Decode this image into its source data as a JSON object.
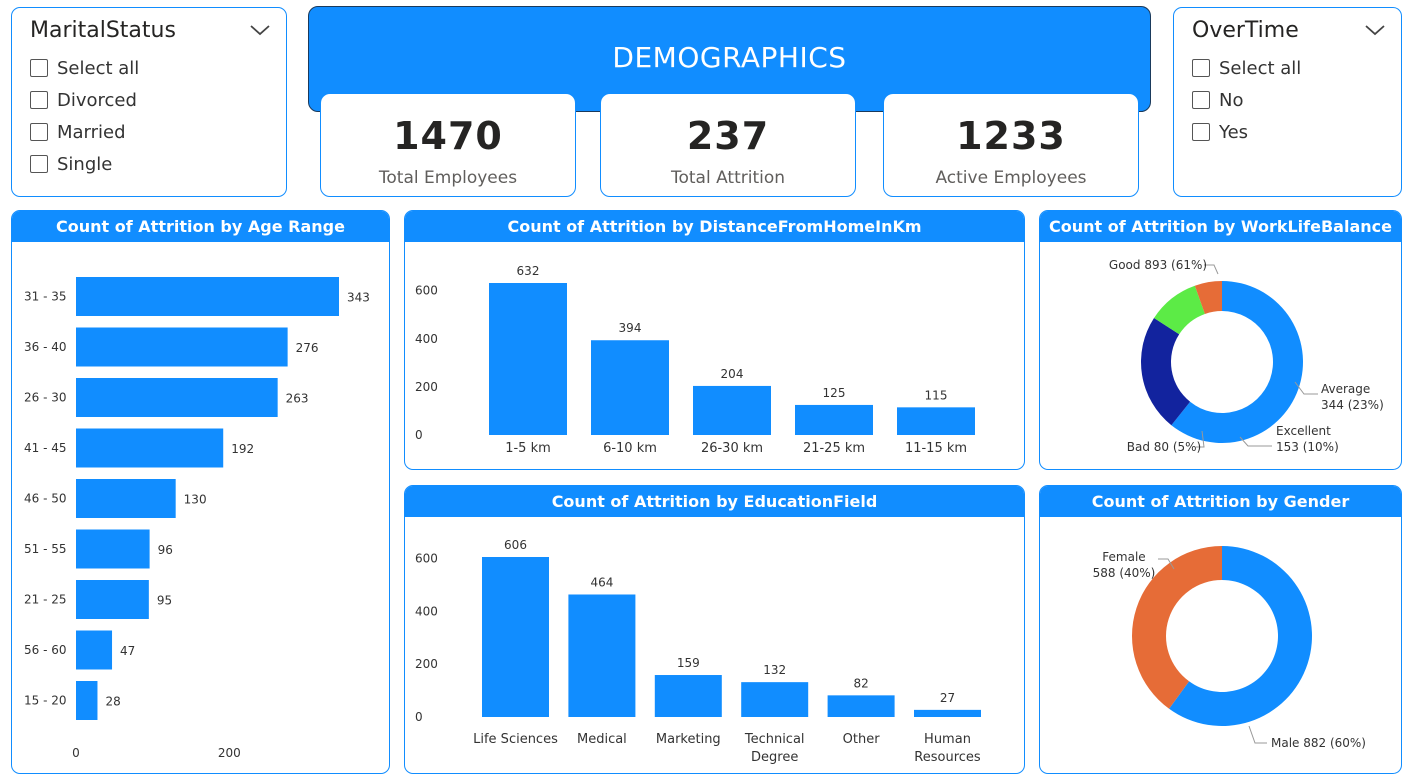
{
  "colors": {
    "accent": "#118DFF",
    "dark_blue": "#12239E",
    "orange": "#E66C37",
    "green": "#5CEB46"
  },
  "marital_slicer": {
    "title": "MaritalStatus",
    "items": [
      "Select all",
      "Divorced",
      "Married",
      "Single"
    ]
  },
  "overtime_slicer": {
    "title": "OverTime",
    "items": [
      "Select all",
      "No",
      "Yes"
    ]
  },
  "header": {
    "title": "DEMOGRAPHICS"
  },
  "kpis": [
    {
      "value": "1470",
      "label": "Total Employees"
    },
    {
      "value": "237",
      "label": "Total Attrition"
    },
    {
      "value": "1233",
      "label": "Active Employees"
    }
  ],
  "chart_data": [
    {
      "type": "bar",
      "orientation": "horizontal",
      "title": "Count of Attrition by Age Range",
      "categories": [
        "31 - 35",
        "36 - 40",
        "26 - 30",
        "41 - 45",
        "46 - 50",
        "51 - 55",
        "21 - 25",
        "56 - 60",
        "15 - 20"
      ],
      "values": [
        343,
        276,
        263,
        192,
        130,
        96,
        95,
        47,
        28
      ],
      "x_ticks": [
        0,
        200
      ],
      "xlim": [
        0,
        343
      ]
    },
    {
      "type": "bar",
      "title": "Count of Attrition by DistanceFromHomeInKm",
      "categories": [
        "1-5 km",
        "6-10 km",
        "26-30 km",
        "21-25 km",
        "11-15 km"
      ],
      "values": [
        632,
        394,
        204,
        125,
        115
      ],
      "y_ticks": [
        0,
        200,
        400,
        600
      ],
      "ylim": [
        0,
        632
      ]
    },
    {
      "type": "bar",
      "title": "Count of Attrition by EducationField",
      "categories": [
        [
          "Life Sciences"
        ],
        [
          "Medical"
        ],
        [
          "Marketing"
        ],
        [
          "Technical",
          "Degree"
        ],
        [
          "Other"
        ],
        [
          "Human",
          "Resources"
        ]
      ],
      "values": [
        606,
        464,
        159,
        132,
        82,
        27
      ],
      "y_ticks": [
        0,
        200,
        400,
        600
      ],
      "ylim": [
        0,
        606
      ]
    },
    {
      "type": "pie",
      "donut": true,
      "title": "Count of Attrition by WorkLifeBalance",
      "slices": [
        {
          "name": "Good",
          "value": 893,
          "percent": "61%",
          "color": "#118DFF",
          "label": [
            "Good 893 (61%)"
          ]
        },
        {
          "name": "Average",
          "value": 344,
          "percent": "23%",
          "color": "#12239E",
          "label": [
            "Average",
            "344 (23%)"
          ]
        },
        {
          "name": "Excellent",
          "value": 153,
          "percent": "10%",
          "color": "#5CEB46",
          "label": [
            "Excellent",
            "153 (10%)"
          ]
        },
        {
          "name": "Bad",
          "value": 80,
          "percent": "5%",
          "color": "#E66C37",
          "label": [
            "Bad 80 (5%)"
          ]
        }
      ]
    },
    {
      "type": "pie",
      "donut": true,
      "title": "Count of Attrition by Gender",
      "slices": [
        {
          "name": "Male",
          "value": 882,
          "percent": "60%",
          "color": "#118DFF",
          "label": [
            "Male 882 (60%)"
          ]
        },
        {
          "name": "Female",
          "value": 588,
          "percent": "40%",
          "color": "#E66C37",
          "label": [
            "Female",
            "588 (40%)"
          ]
        }
      ]
    }
  ]
}
